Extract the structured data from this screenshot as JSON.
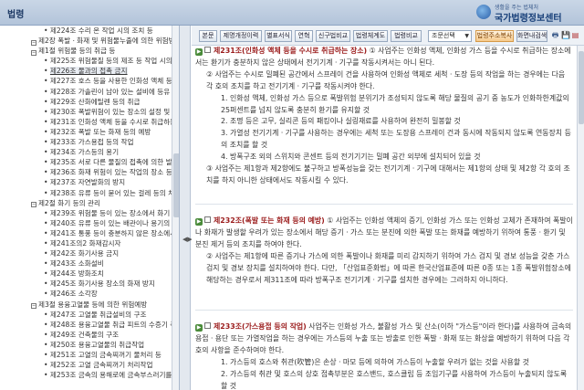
{
  "header": {
    "title": "법령",
    "logo_tagline": "생활을 주는 법체처",
    "logo_name": "국가법령정보센터"
  },
  "tree": [
    {
      "level": 2,
      "label": "제224조 수리 온 작업 시의 조치 등"
    },
    {
      "level": 1,
      "label": "제2장 폭발ㆍ화재 및 위험물누출에 의한 위험방"
    },
    {
      "level": 1,
      "label": "제1절 위험물 등의 취급 등"
    },
    {
      "level": 2,
      "label": "제225조 위험물질 등의 제조 등 작업 시의 조"
    },
    {
      "level": 2,
      "label": "제226조 물과의 접촉 금지",
      "selected": true
    },
    {
      "level": 2,
      "label": "제227조 호스 등을 사용한 인화성 액체 등의"
    },
    {
      "level": 2,
      "label": "제228조 가솔린이 남아 있는 설비에 등유 등"
    },
    {
      "level": 2,
      "label": "제229조 산화에틸렌 등의 취급"
    },
    {
      "level": 2,
      "label": "제230조 폭발위험이 있는 장소의 설정 및 관"
    },
    {
      "level": 2,
      "label": "제231조 인화성 액체 등을 수시로 취급하는 장"
    },
    {
      "level": 2,
      "label": "제232조 폭발 또는 화재 등의 예방"
    },
    {
      "level": 2,
      "label": "제233조 가스용접 등의 작업"
    },
    {
      "level": 2,
      "label": "제234조 가스등의 용기"
    },
    {
      "level": 2,
      "label": "제235조 서로 다른 물질의 접촉에 의한 발화"
    },
    {
      "level": 2,
      "label": "제236조 화재 위험이 있는 작업의 장소 등"
    },
    {
      "level": 2,
      "label": "제237조 자연발화의 방지"
    },
    {
      "level": 2,
      "label": "제238조 유류 등이 묻어 있는 걸레 등의 처리"
    },
    {
      "level": 1,
      "label": "제2절 화기 등의 관리"
    },
    {
      "level": 2,
      "label": "제239조 위험물 등이 있는 장소에서 화기 등"
    },
    {
      "level": 2,
      "label": "제240조 유류 등이 있는 배관이나 용기의 용"
    },
    {
      "level": 2,
      "label": "제241조 통풍 등이 충분하지 않은 장소에서의"
    },
    {
      "level": 2,
      "label": "제241조의2 화재감시자"
    },
    {
      "level": 2,
      "label": "제242조 화기사용 금지"
    },
    {
      "level": 2,
      "label": "제243조 소화설비"
    },
    {
      "level": 2,
      "label": "제244조 방화조치"
    },
    {
      "level": 2,
      "label": "제245조 화기사용 장소의 화재 방지"
    },
    {
      "level": 2,
      "label": "제246조 소각장"
    },
    {
      "level": 1,
      "label": "제3절 용융고열물 등에 의한 위험예방"
    },
    {
      "level": 2,
      "label": "제247조 고열물 취급설비의 구조"
    },
    {
      "level": 2,
      "label": "제248조 용융고열물 취급 피트의 수증기 폭발"
    },
    {
      "level": 2,
      "label": "제249조 건축물의 구조"
    },
    {
      "level": 2,
      "label": "제250조 용융고열물의 취급작업"
    },
    {
      "level": 2,
      "label": "제251조 고열의 금속찌꺼기 물처리 등"
    },
    {
      "level": 2,
      "label": "제252조 고열 금속찌꺼기 처리작업"
    },
    {
      "level": 2,
      "label": "제253조 금속의 용해로에 금속부스러기를 넣"
    }
  ],
  "toolbar": {
    "buttons": [
      "본문",
      "제명개정이력",
      "별표서식",
      "연혁",
      "신구법비교",
      "법령체계도",
      "법령비교"
    ],
    "select_value": "조문선택",
    "select_caret": "▼",
    "orange_button": "법령주소복사",
    "last_button": "화면내검색",
    "icon_print": "🖶",
    "icon_save": "💾",
    "icon_mark": "▤"
  },
  "articles": [
    {
      "title": "제231조(인화성 액체 등을 수시로 취급하는 장소)",
      "lead": " ① 사업주는 인화성 액체, 인화성 가스 등을 수시로 취급하는 장소에서는 환기가 충분하지 않은 상태에서 전기기계ㆍ기구를 작동시켜서는 아니 된다.",
      "paragraphs": [
        {
          "indent": 1,
          "text": "② 사업주는 수시로 밀폐된 공간에서 스프레이 건을 사용하여 인화성 액체로 세척ㆍ도장 등의 작업을 하는 경우에는 다음 각 호의 조치를 하고 전기기계ㆍ기구를 작동시켜야 한다."
        },
        {
          "indent": 2,
          "text": "1. 인화성 액체, 인화성 가스 등으로 폭발위험 분위기가 조성되지 않도록 해당 물질의 공기 중 농도가 인화하한계값의 25퍼센트를 넘지 않도록 충분히 환기를 유지할 것"
        },
        {
          "indent": 2,
          "text": "2. 조명 등은 고무, 실리콘 등의 패킹이나 실링재료를 사용하여 완전히 밀봉할 것"
        },
        {
          "indent": 2,
          "text": "3. 가열성 전기기계ㆍ기구를 사용하는 경우에는 세척 또는 도장용 스프레이 건과 동시에 작동되지 않도록 연동장치 등의 조치를 할 것"
        },
        {
          "indent": 2,
          "text": "4. 방폭구조 외의 스위치와 콘센트 등의 전기기기는 밀폐 공간 외부에 설치되어 있을 것"
        },
        {
          "indent": 1,
          "text": "③ 사업주는 제1항과 제2항에도 불구하고 방폭성능을 갖는 전기기계ㆍ기구에 대해서는 제1항의 상태 및 제2항 각 호의 조치를 하지 아니한 상태에서도 작동시킬 수 있다."
        }
      ]
    },
    {
      "title": "제232조(폭발 또는 화재 등의 예방)",
      "lead": " ① 사업주는 인화성 액체의 증기, 인화성 가스 또는 인화성 고체가 존재하여 폭발이나 화재가 발생할 우려가 있는 장소에서 해당 증기ㆍ가스 또는 분진에 의한 폭발 또는 화재를 예방하기 위하여 통풍ㆍ환기 및 분진 제거 등의 조치를 하여야 한다.",
      "paragraphs": [
        {
          "indent": 1,
          "text": "② 사업주는 제1항에 따른 증기나 가스에 의한 폭발이나 화재를 미리 감지하기 위하여 가스 검지 및 경보 성능을 갖춘 가스 검지 및 경보 장치를 설치하여야 한다. 다만, 「산업표준화법」에 따른 한국산업표준에 따른 0종 또는 1종 폭발위험장소에 해당하는 경우로서 제311조에 따라 방폭구조 전기기계ㆍ기구를 설치한 경우에는 그러하지 아니하다."
        }
      ]
    },
    {
      "title": "제233조(가스용접 등의 작업)",
      "lead": " 사업주는 인화성 가스, 불활성 가스 및 산소(이하 \"가스등\"이라 한다)를 사용하여 금속의 용접ㆍ용단 또는 가열작업을 하는 경우에는 가스등의 누출 또는 방출로 인한 폭발ㆍ화재 또는 화상을 예방하기 위하여 다음 각 호의 사항을 준수하여야 한다.",
      "paragraphs": [
        {
          "indent": 2,
          "text": "1. 가스등의 호스와 취관(吹管)은 손상ㆍ마모 등에 의하여 가스등이 누출할 우려가 없는 것을 사용할 것"
        },
        {
          "indent": 2,
          "text": "2. 가스등의 취관 및 호스의 상호 접촉부분은 호스밴드, 호스클립 등 조임기구를 사용하여 가스등이 누출되지 않도록 할 것"
        }
      ]
    }
  ],
  "splitter_icon": "◀▶"
}
